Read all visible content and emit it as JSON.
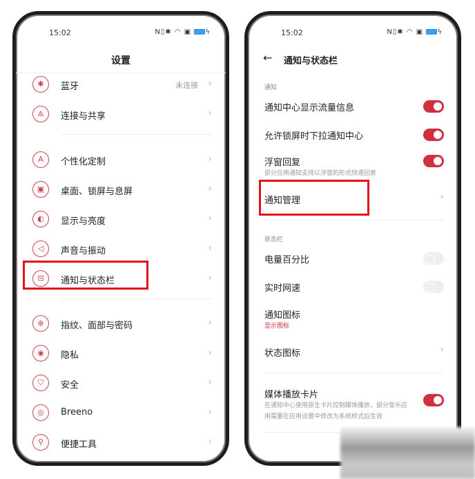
{
  "left": {
    "status_time": "15:02",
    "title": "设置",
    "items": [
      {
        "label": "蓝牙",
        "value": "未连接",
        "icon": "bluetooth-icon",
        "glyph": "✱"
      },
      {
        "label": "连接与共享",
        "icon": "share-icon",
        "glyph": "⟁"
      },
      {
        "label": "个性化定制",
        "icon": "personalize-icon",
        "glyph": "A"
      },
      {
        "label": "桌面、锁屏与息屏",
        "icon": "wallpaper-icon",
        "glyph": "▣"
      },
      {
        "label": "显示与亮度",
        "icon": "brightness-icon",
        "glyph": "◐"
      },
      {
        "label": "声音与振动",
        "icon": "sound-icon",
        "glyph": "◁"
      },
      {
        "label": "通知与状态栏",
        "icon": "notification-icon",
        "glyph": "⊟"
      },
      {
        "label": "指纹、面部与密码",
        "icon": "lock-icon",
        "glyph": "⊕"
      },
      {
        "label": "隐私",
        "icon": "privacy-icon",
        "glyph": "◉"
      },
      {
        "label": "安全",
        "icon": "shield-icon",
        "glyph": "⛉"
      },
      {
        "label": "Breeno",
        "icon": "breeno-icon",
        "glyph": "◎"
      },
      {
        "label": "便捷工具",
        "icon": "tools-icon",
        "glyph": "⚲"
      }
    ]
  },
  "right": {
    "status_time": "15:02",
    "title": "通知与状态栏",
    "section_notify": "通知",
    "section_status": "状态栏",
    "items": [
      {
        "label": "通知中心显示流量信息",
        "toggle": true
      },
      {
        "label": "允许锁屏时下拉通知中心",
        "toggle": true
      },
      {
        "label": "浮窗回复",
        "sub": "部分应用通知支持以浮窗的形式快速回复",
        "toggle": true
      },
      {
        "label": "通知管理",
        "chevron": true
      },
      {
        "label": "电量百分比",
        "toggle": false
      },
      {
        "label": "实时网速",
        "toggle": false
      },
      {
        "label": "通知图标",
        "sub": "显示图标"
      },
      {
        "label": "状态图标",
        "chevron": true
      },
      {
        "label": "媒体播放卡片",
        "sub": "在通知中心使用原生卡片控制媒体播放，部分音乐应用需要在应用设置中修改为系统样式后生效",
        "toggle": true
      }
    ]
  },
  "colors": {
    "accent": "#d0303e",
    "highlight": "#e1141c"
  }
}
